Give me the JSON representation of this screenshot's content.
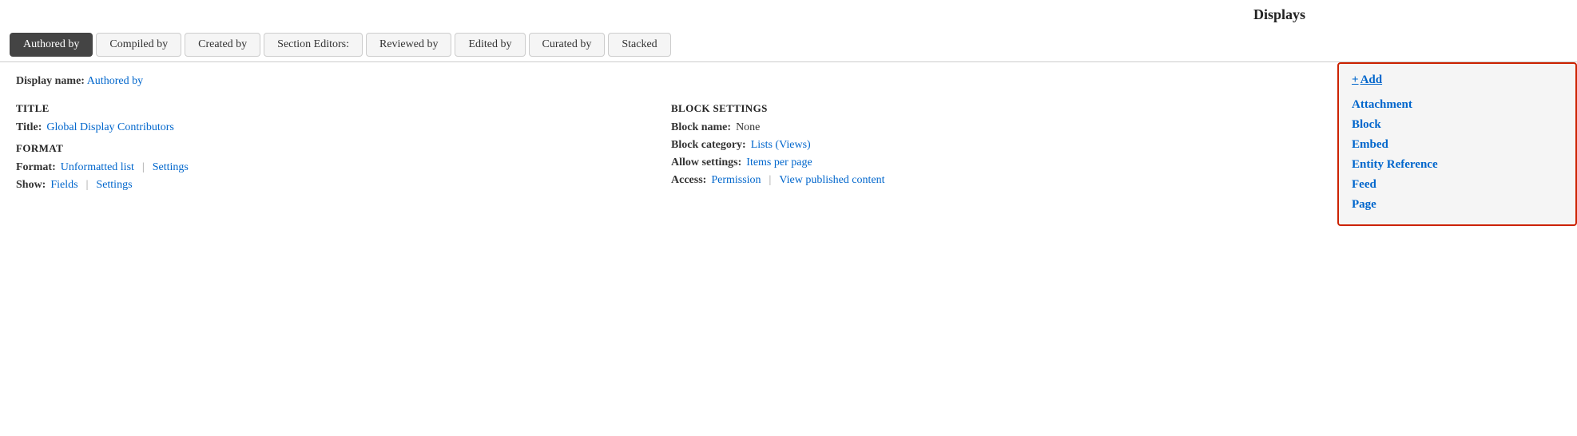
{
  "header": {
    "title": "Displays"
  },
  "tabs": [
    {
      "id": "authored-by",
      "label": "Authored by",
      "active": true
    },
    {
      "id": "compiled-by",
      "label": "Compiled by",
      "active": false
    },
    {
      "id": "created-by",
      "label": "Created by",
      "active": false
    },
    {
      "id": "section-editors",
      "label": "Section Editors:",
      "active": false
    },
    {
      "id": "reviewed-by",
      "label": "Reviewed by",
      "active": false
    },
    {
      "id": "edited-by",
      "label": "Edited by",
      "active": false
    },
    {
      "id": "curated-by",
      "label": "Curated by",
      "active": false
    },
    {
      "id": "stacked",
      "label": "Stacked",
      "active": false
    }
  ],
  "display_name": {
    "label": "Display name:",
    "value": "Authored by"
  },
  "left_panel": {
    "title_section": {
      "heading": "TITLE",
      "field_label": "Title:",
      "field_value": "Global Display Contributors"
    },
    "format_section": {
      "heading": "FORMAT",
      "format_label": "Format:",
      "format_value": "Unformatted list",
      "format_settings": "Settings",
      "show_label": "Show:",
      "show_value": "Fields",
      "show_settings": "Settings"
    }
  },
  "right_panel": {
    "heading": "BLOCK SETTINGS",
    "block_name_label": "Block name:",
    "block_name_value": "None",
    "block_category_label": "Block category:",
    "block_category_value": "Lists (Views)",
    "allow_settings_label": "Allow settings:",
    "allow_settings_value": "Items per page",
    "access_label": "Access:",
    "access_value": "Permission",
    "access_separator": "|",
    "access_link": "View published content"
  },
  "dropdown": {
    "add_label": "Add",
    "items": [
      {
        "id": "attachment",
        "label": "Attachment"
      },
      {
        "id": "block",
        "label": "Block"
      },
      {
        "id": "embed",
        "label": "Embed"
      },
      {
        "id": "entity-reference",
        "label": "Entity Reference"
      },
      {
        "id": "feed",
        "label": "Feed"
      },
      {
        "id": "page",
        "label": "Page"
      }
    ]
  }
}
